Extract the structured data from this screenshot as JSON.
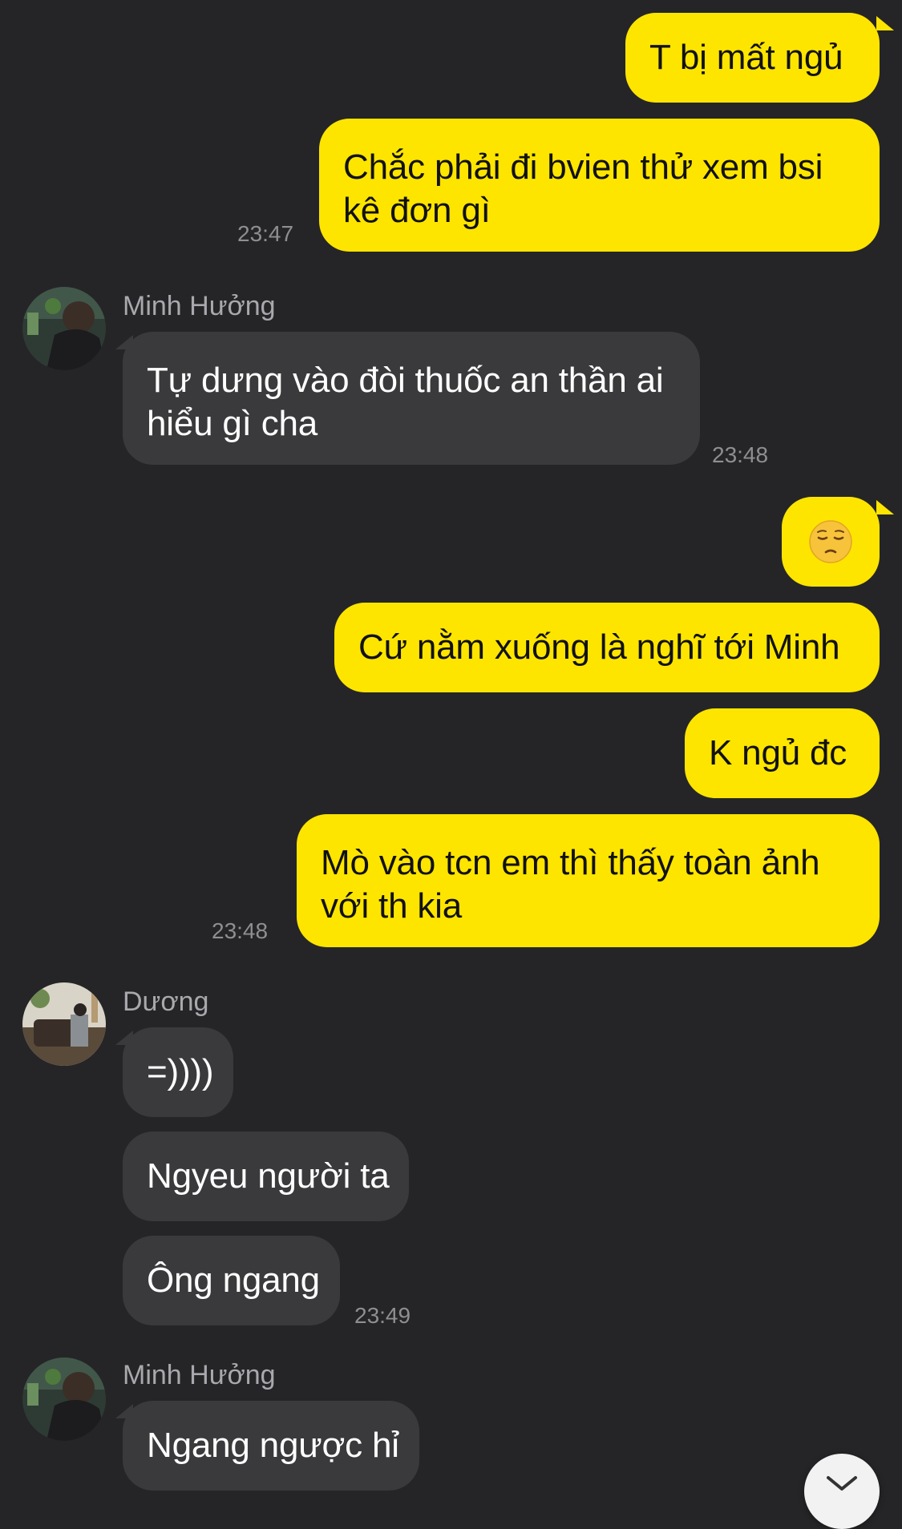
{
  "colors": {
    "background": "#252527",
    "outgoing_bubble": "#fee500",
    "incoming_bubble": "#3a3a3c",
    "timestamp": "#8e8e93"
  },
  "messages": {
    "m1": "T bị mất ngủ",
    "m2": "Chắc phải đi bvien thử xem bsi kê đơn gì",
    "m2_time": "23:47",
    "sender1": "Minh Hưởng",
    "m3": "Tự dưng vào đòi thuốc an thần ai hiểu gì cha",
    "m3_time": "23:48",
    "m4_emoji": "pensive-face-emoji",
    "m5": "Cứ nằm xuống là nghĩ tới Minh",
    "m6": "K ngủ đc",
    "m7": "Mò vào tcn em thì thấy toàn ảnh với th kia",
    "m7_time": "23:48",
    "sender2": "Dương",
    "m8": "=))))",
    "m9": "Ngyeu người ta",
    "m10": "Ông ngang",
    "m10_time": "23:49",
    "sender3": "Minh Hưởng",
    "m11": "Ngang ngược hỉ"
  },
  "icons": {
    "scroll_down": "chevron-down-icon"
  }
}
